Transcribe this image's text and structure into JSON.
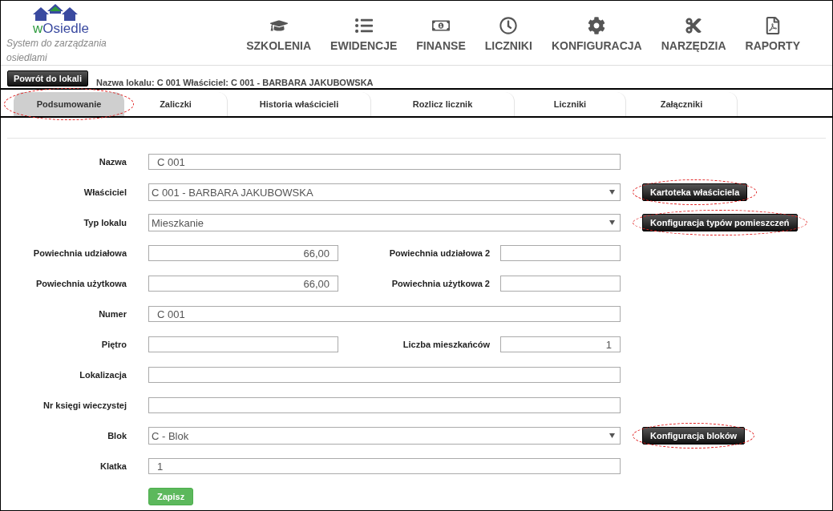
{
  "logo": {
    "name": "wOsiedle",
    "tagline": "System do zarządzania osiedlami"
  },
  "nav": [
    {
      "label": "SZKOLENIA"
    },
    {
      "label": "EWIDENCJE"
    },
    {
      "label": "FINANSE"
    },
    {
      "label": "LICZNIKI"
    },
    {
      "label": "KONFIGURACJA"
    },
    {
      "label": "NARZĘDZIA"
    },
    {
      "label": "RAPORTY"
    }
  ],
  "back_button": "Powrót do lokali",
  "info": "Nazwa lokalu: C 001 Właściciel: C 001 - BARBARA JAKUBOWSKA",
  "tabs": [
    {
      "label": "Podsumowanie",
      "selected": true,
      "highlighted": true
    },
    {
      "label": "Zaliczki",
      "selected": false,
      "highlighted": false
    },
    {
      "label": "Historia właścicieli",
      "selected": false,
      "highlighted": false
    },
    {
      "label": "Rozlicz licznik",
      "selected": false,
      "highlighted": false
    },
    {
      "label": "Liczniki",
      "selected": false,
      "highlighted": false
    },
    {
      "label": "Załączniki",
      "selected": false,
      "highlighted": false
    }
  ],
  "rows": [
    {
      "kind": "text",
      "label": "Nazwa",
      "value": "C 001"
    },
    {
      "kind": "select",
      "label": "Właściciel",
      "value": "C 001 - BARBARA JAKUBOWSKA",
      "action": {
        "label": "Kartoteka właściciela",
        "highlighted": true
      }
    },
    {
      "kind": "select",
      "label": "Typ lokalu",
      "value": "Mieszkanie",
      "action": {
        "label": "Konfiguracja typów pomieszczeń",
        "highlighted": true
      }
    },
    {
      "kind": "pair",
      "fields": [
        {
          "label": "Powiechnia udziałowa",
          "value": "66,00"
        },
        {
          "label": "Powiechnia udziałowa 2"
        }
      ]
    },
    {
      "kind": "pair",
      "fields": [
        {
          "label": "Powiechnia użytkowa",
          "value": "66,00"
        },
        {
          "label": "Powiechnia użytkowa 2"
        }
      ]
    },
    {
      "kind": "text",
      "label": "Numer",
      "value": "C 001"
    },
    {
      "kind": "pair",
      "fields": [
        {
          "label": "Piętro"
        },
        {
          "label": "Liczba mieszkańców",
          "value": "1"
        }
      ]
    },
    {
      "kind": "text",
      "label": "Lokalizacja"
    },
    {
      "kind": "text",
      "label": "Nr księgi wieczystej"
    },
    {
      "kind": "select",
      "label": "Blok",
      "value": "C - Blok",
      "action": {
        "label": "Konfiguracja bloków",
        "highlighted": true
      }
    },
    {
      "kind": "text",
      "label": "Klatka",
      "value": "1"
    }
  ],
  "save_button": "Zapisz"
}
